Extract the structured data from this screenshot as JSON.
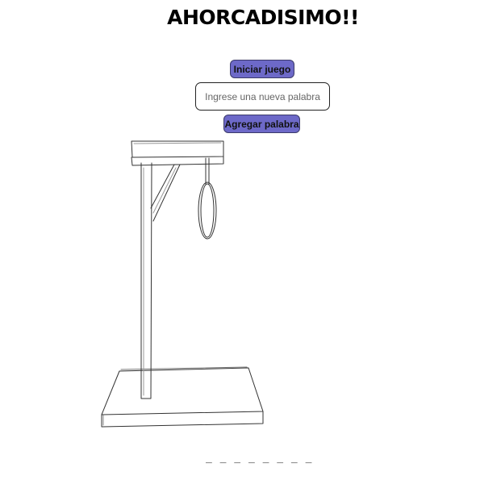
{
  "header": {
    "title": "AHORCADISIMO!!"
  },
  "controls": {
    "start_label": "Iniciar juego",
    "word_input_value": "",
    "word_input_placeholder": "Ingrese una nueva palabra",
    "add_label": "Agregar palabra"
  },
  "game": {
    "hidden_word_display": "_ _ _ _ _ _ _ _"
  },
  "colors": {
    "button_bg": "#6d69c8",
    "button_border": "#3b3a6a"
  }
}
